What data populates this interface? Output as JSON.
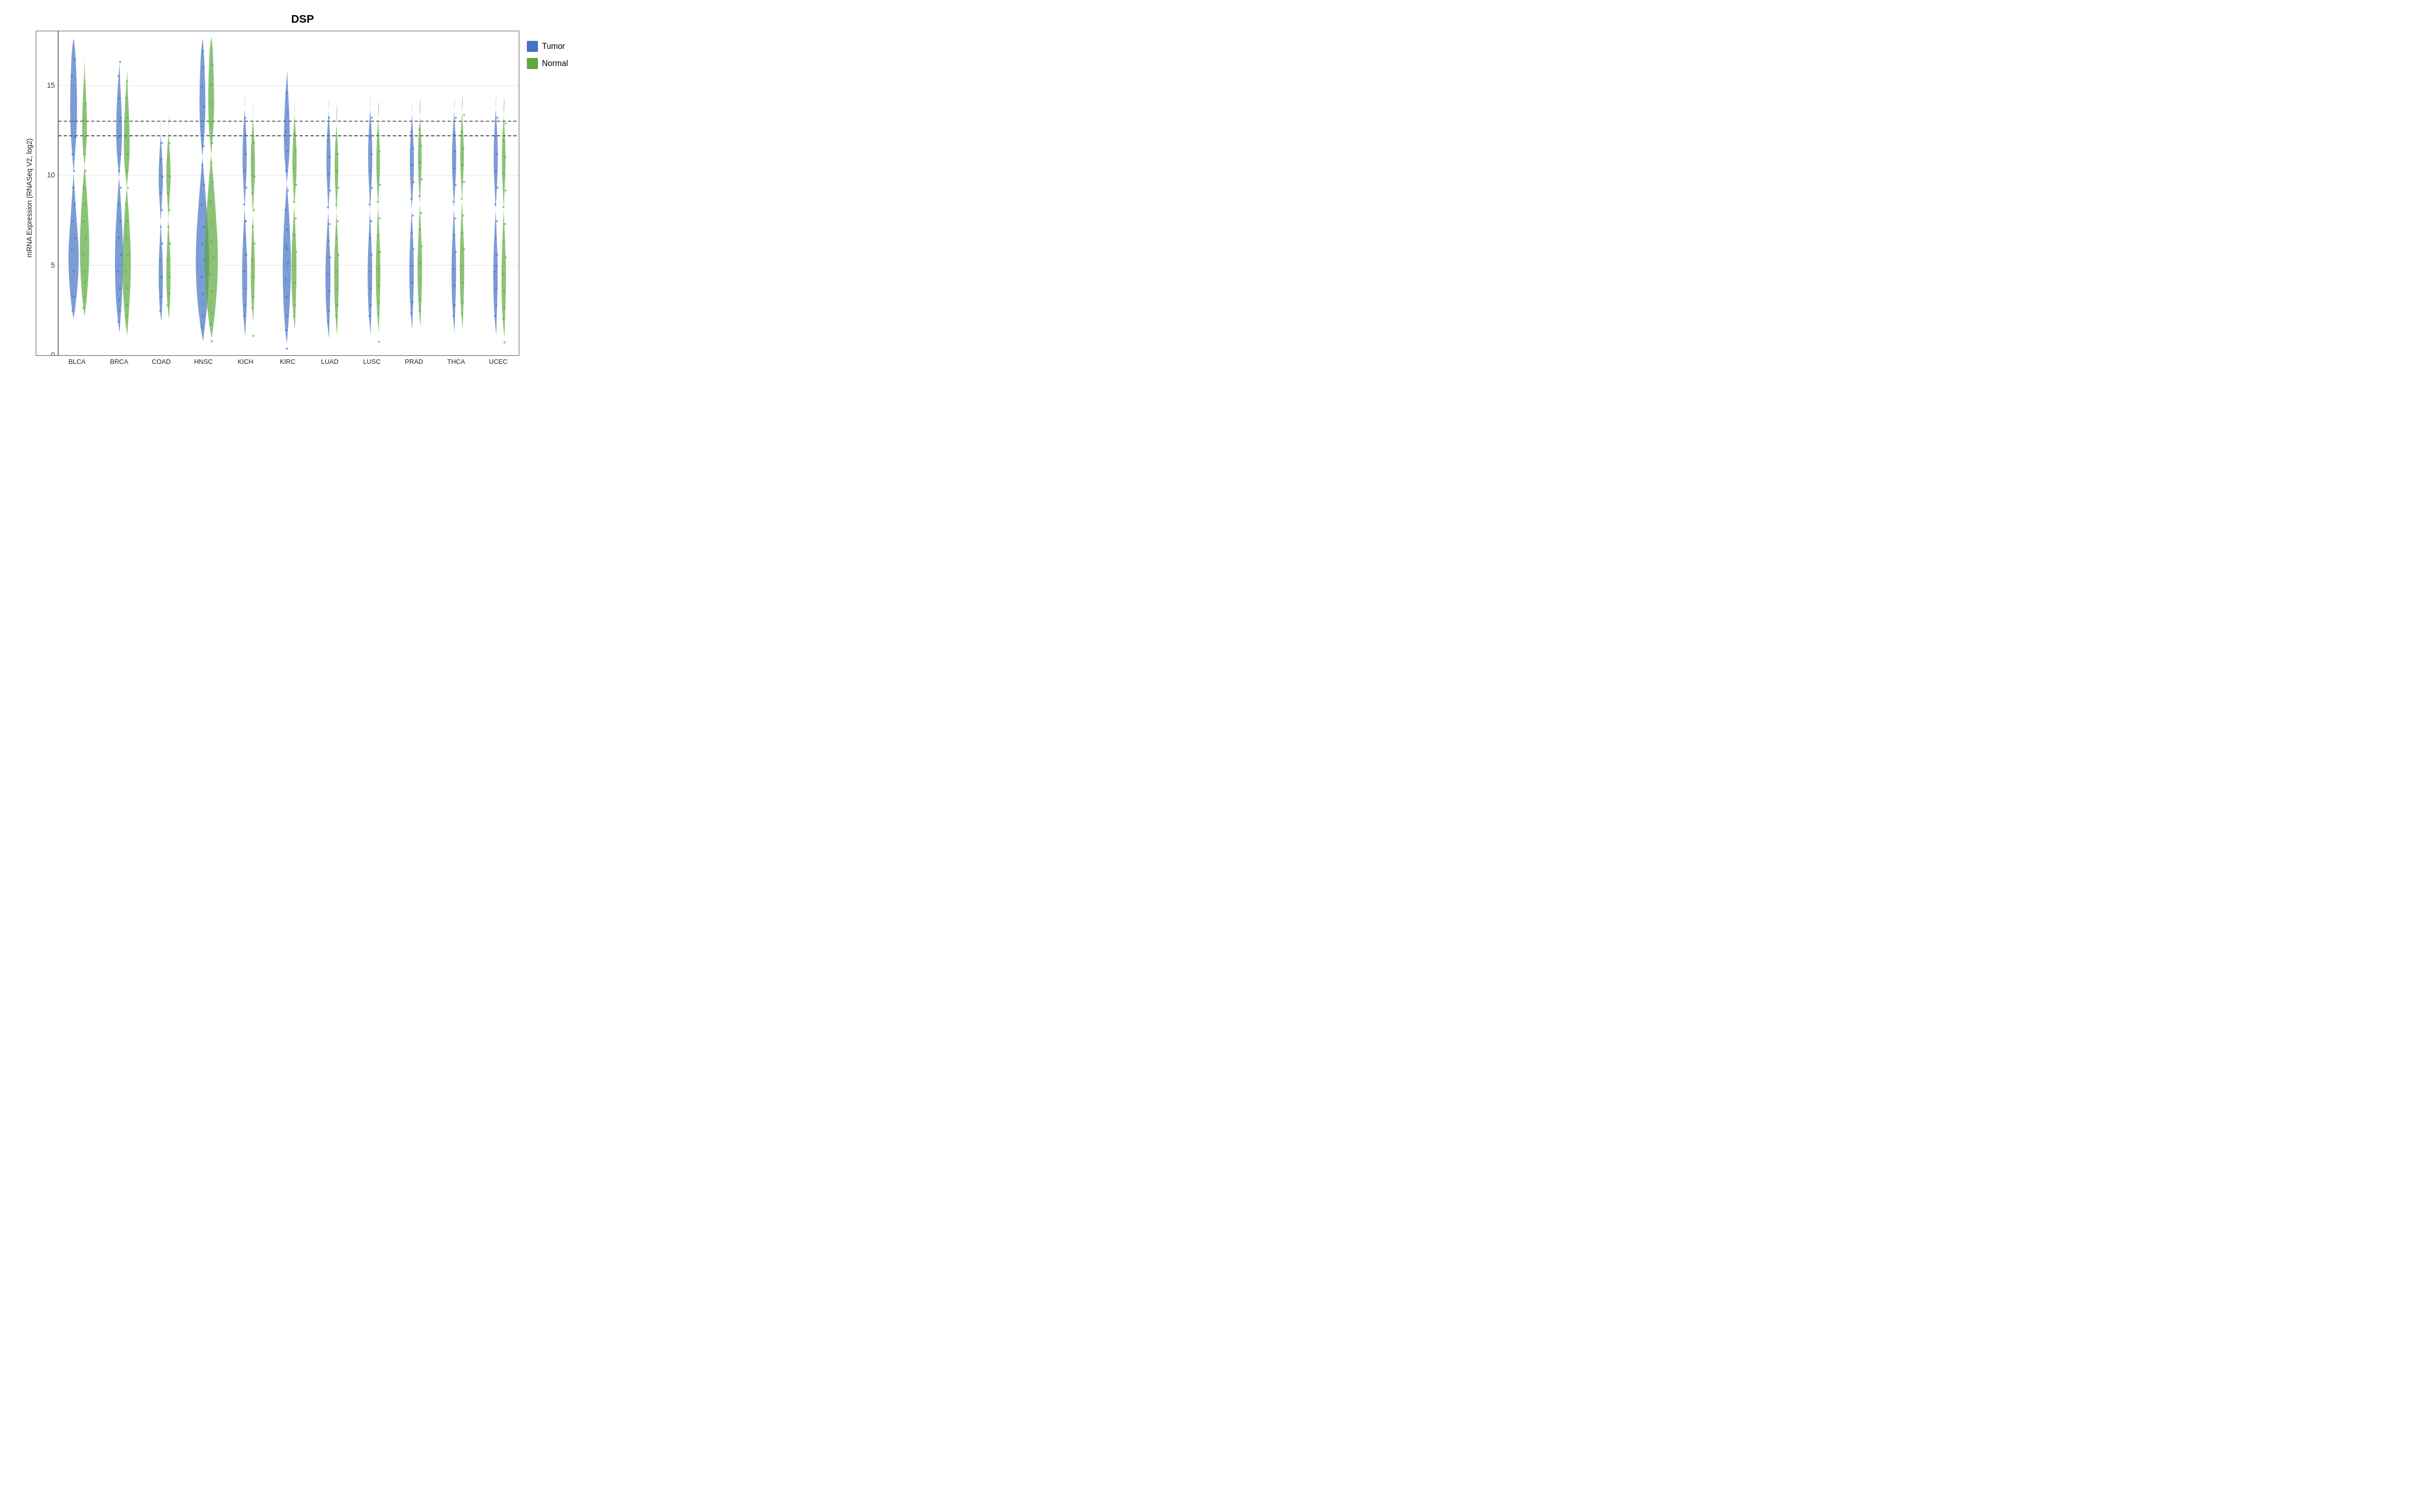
{
  "title": "DSP",
  "yAxisLabel": "mRNA Expression (RNASeq V2, log2)",
  "xLabels": [
    "BLCA",
    "BRCA",
    "COAD",
    "HNSC",
    "KICH",
    "KIRC",
    "LUAD",
    "LUSC",
    "PRAD",
    "THCA",
    "UCEC"
  ],
  "legend": {
    "items": [
      {
        "label": "Tumor",
        "color": "#4472C4"
      },
      {
        "label": "Normal",
        "color": "#5AAA3C"
      }
    ]
  },
  "yAxis": {
    "min": 0,
    "max": 18,
    "ticks": [
      0,
      5,
      10,
      15
    ]
  },
  "dottedLines": [
    12.2,
    13.0
  ]
}
